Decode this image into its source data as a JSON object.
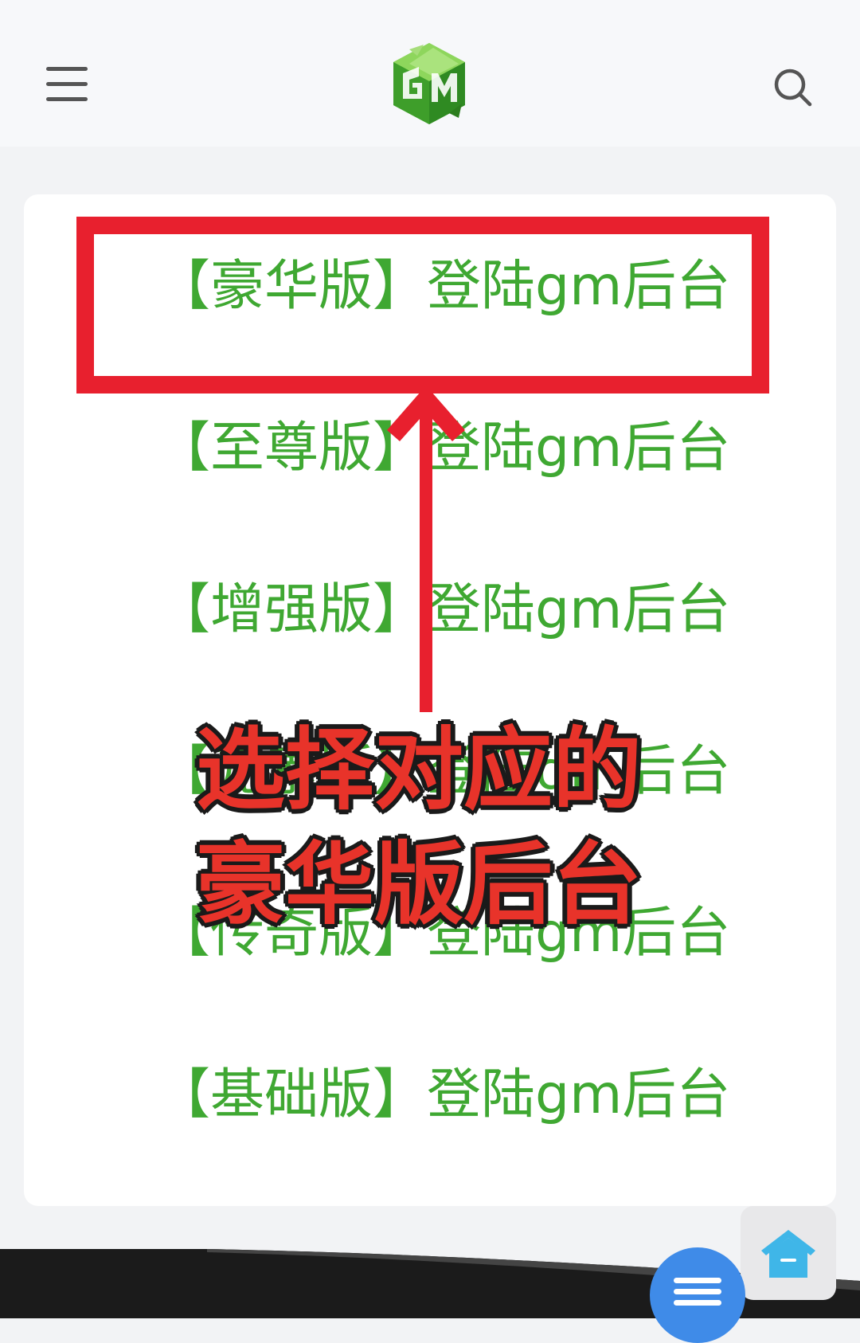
{
  "header": {
    "menu_icon": "hamburger-menu-icon",
    "logo_text": "GM",
    "search_icon": "search-icon"
  },
  "links": [
    {
      "label": "【豪华版】登陆gm后台"
    },
    {
      "label": "【至尊版】登陆gm后台"
    },
    {
      "label": "【增强版】登陆gm后台"
    },
    {
      "label": "【元素版】登陆gm后台"
    },
    {
      "label": "【传奇版】登陆gm后台"
    },
    {
      "label": "【基础版】登陆gm后台"
    }
  ],
  "annotation": {
    "line1": "选择对应的",
    "line2": "豪华版后台"
  },
  "colors": {
    "link_green": "#3fa832",
    "highlight_red": "#e8202e",
    "annotation_red": "#e8332a",
    "fab_blue": "#3f8be8",
    "home_blue": "#3fb6e8"
  },
  "footer": {
    "home_icon": "home-icon",
    "fab_icon": "list-menu-icon"
  }
}
